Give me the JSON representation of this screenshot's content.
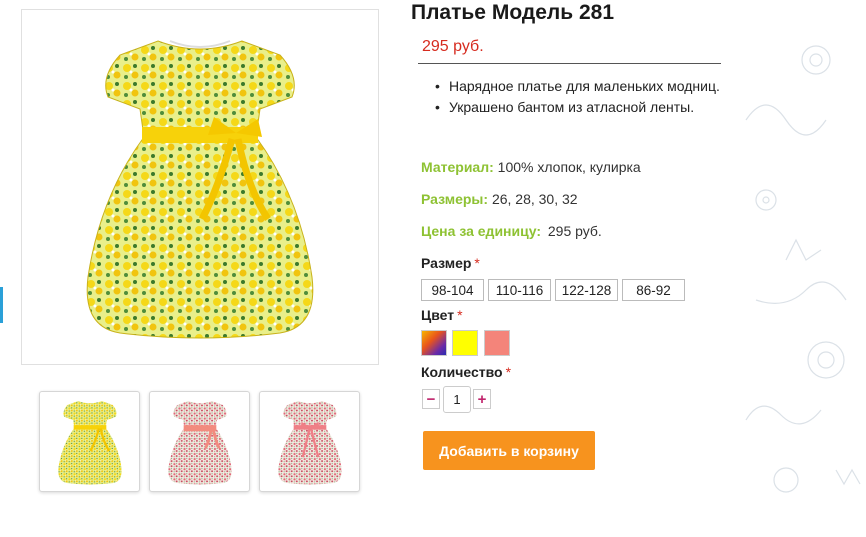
{
  "product": {
    "title": "Платье Модель 281",
    "price": "295 руб.",
    "bullets": [
      "Нарядное платье для маленьких модниц.",
      "Украшено бантом из атласной ленты."
    ],
    "specs": {
      "material_key": "Материал:",
      "material_val": "100% хлопок, кулирка",
      "sizes_key": "Размеры:",
      "sizes_val": "26, 28, 30, 32",
      "unit_price_key": "Цена за единицу:",
      "unit_price_val": "295 руб."
    }
  },
  "options": {
    "size_label": "Размер",
    "sizes": [
      "98-104",
      "110-116",
      "122-128",
      "86-92"
    ],
    "color_label": "Цвет",
    "colors": [
      "multicolor-gradient",
      "#ffff00",
      "#f4847a"
    ],
    "quantity_label": "Количество",
    "quantity": "1",
    "required_mark": "*"
  },
  "actions": {
    "add_to_cart": "Добавить в корзину",
    "minus": "−",
    "plus": "+"
  },
  "gallery": {
    "main_variant": "yellow",
    "thumbs": [
      "yellow",
      "pink-sash",
      "pink-bow"
    ]
  }
}
